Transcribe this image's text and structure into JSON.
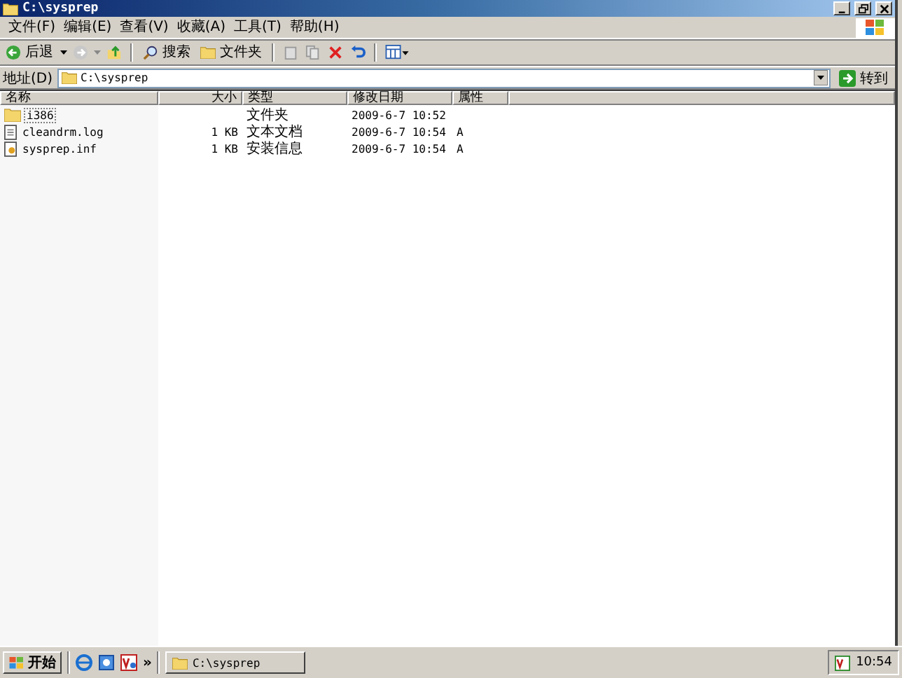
{
  "window": {
    "title": "C:\\sysprep"
  },
  "menu": [
    "文件(F)",
    "编辑(E)",
    "查看(V)",
    "收藏(A)",
    "工具(T)",
    "帮助(H)"
  ],
  "toolbar": {
    "back": "后退",
    "search": "搜索",
    "folders": "文件夹"
  },
  "address": {
    "label": "地址(D)",
    "value": "C:\\sysprep",
    "go": "转到"
  },
  "table": {
    "columns": [
      "名称",
      "大小",
      "类型",
      "修改日期",
      "属性"
    ],
    "rows": [
      {
        "kind": "folder",
        "name": "i386",
        "size": "",
        "type": "文件夹",
        "modified": "2009-6-7 10:52",
        "attributes": "",
        "selected": true
      },
      {
        "kind": "text",
        "name": "cleandrm.log",
        "size": "1 KB",
        "type": "文本文档",
        "modified": "2009-6-7 10:54",
        "attributes": "A",
        "selected": false
      },
      {
        "kind": "setup",
        "name": "sysprep.inf",
        "size": "1 KB",
        "type": "安装信息",
        "modified": "2009-6-7 10:54",
        "attributes": "A",
        "selected": false
      }
    ]
  },
  "taskbar": {
    "start": "开始",
    "more": "»",
    "tasks": [
      {
        "label": "C:\\sysprep",
        "selected": false
      }
    ],
    "clock": "10:54"
  }
}
